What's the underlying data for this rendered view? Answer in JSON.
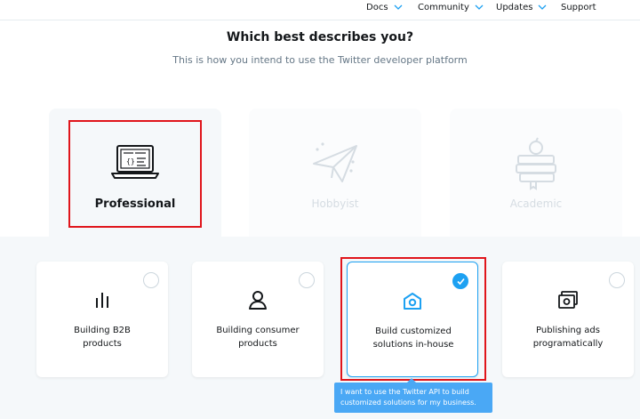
{
  "nav": {
    "docs": "Docs",
    "community": "Community",
    "updates": "Updates",
    "support": "Support"
  },
  "heading": "Which best describes you?",
  "subheading": "This is how you intend to use the Twitter developer platform",
  "personas": [
    {
      "label": "Professional",
      "icon": "laptop-code-icon",
      "state": "active"
    },
    {
      "label": "Hobbyist",
      "icon": "paper-plane-icon",
      "state": "inactive"
    },
    {
      "label": "Academic",
      "icon": "books-apple-icon",
      "state": "inactive"
    }
  ],
  "use_cases": [
    {
      "line1": "Building B2B",
      "line2": "products",
      "icon": "bar-chart-icon",
      "selected": false
    },
    {
      "line1": "Building consumer",
      "line2": "products",
      "icon": "user-icon",
      "selected": false
    },
    {
      "line1": "Build customized",
      "line2": "solutions in-house",
      "icon": "house-icon",
      "selected": true
    },
    {
      "line1": "Publishing ads",
      "line2": "programatically",
      "icon": "money-icon",
      "selected": false
    }
  ],
  "tooltip": {
    "line1": "I want to use the Twitter API to build",
    "line2": "customized solutions for my business."
  },
  "colors": {
    "accent": "#1da1f2",
    "highlight": "#e0151b",
    "tooltip": "#4aa8f5"
  }
}
